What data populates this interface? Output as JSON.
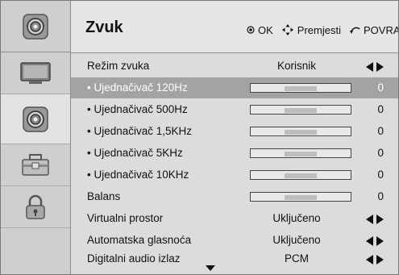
{
  "header": {
    "title": "Zvuk",
    "hints": [
      {
        "icon": "ok-circle-icon",
        "label": "OK"
      },
      {
        "icon": "navigation-arrows-icon",
        "label": "Premjesti"
      },
      {
        "icon": "return-icon",
        "label": "POVRAT"
      }
    ]
  },
  "sidebar": {
    "items": [
      {
        "icon": "speaker-icon"
      },
      {
        "icon": "monitor-icon"
      },
      {
        "icon": "speaker-icon"
      },
      {
        "icon": "toolbox-icon"
      },
      {
        "icon": "lock-icon"
      },
      {
        "icon": "empty"
      }
    ]
  },
  "rows": [
    {
      "label": "Režim zvuka",
      "value": "Korisnik",
      "kind": "option"
    },
    {
      "label": "• Ujednačivač 120Hz",
      "value": "0",
      "kind": "slider",
      "level": 0.5
    },
    {
      "label": "• Ujednačivač 500Hz",
      "value": "0",
      "kind": "slider",
      "level": 0.5
    },
    {
      "label": "• Ujednačivač 1,5KHz",
      "value": "0",
      "kind": "slider",
      "level": 0.5
    },
    {
      "label": "• Ujednačivač 5KHz",
      "value": "0",
      "kind": "slider",
      "level": 0.5
    },
    {
      "label": "• Ujednačivač 10KHz",
      "value": "0",
      "kind": "slider",
      "level": 0.5
    },
    {
      "label": "Balans",
      "value": "0",
      "kind": "slider",
      "level": 0.5
    },
    {
      "label": "Virtualni prostor",
      "value": "Uključeno",
      "kind": "option"
    },
    {
      "label": "Automatska glasnoća",
      "value": "Uključeno",
      "kind": "option"
    },
    {
      "label": "Digitalni audio izlaz",
      "value": "PCM",
      "kind": "option"
    }
  ],
  "selected_row": 1,
  "colors": {
    "selected_row": "#a3a3a3",
    "background": "#dcdcdc"
  }
}
